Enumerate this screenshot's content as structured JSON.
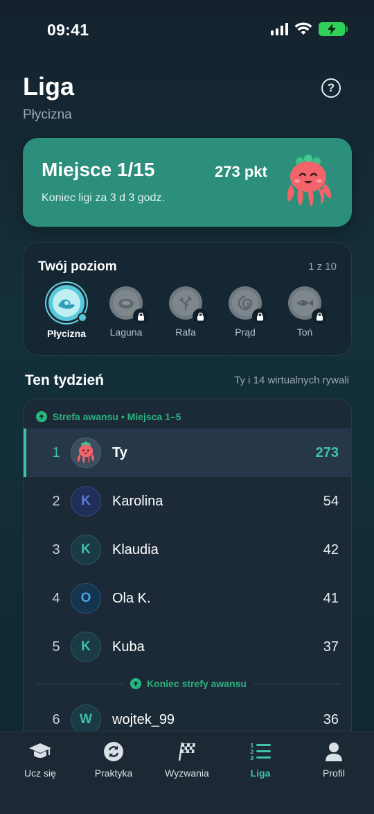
{
  "status": {
    "time": "09:41"
  },
  "header": {
    "title": "Liga",
    "subtitle": "Płycizna",
    "help_icon": "question-circle-icon"
  },
  "rank_card": {
    "place": "Miejsce 1/15",
    "points": "273 pkt",
    "ends": "Koniec ligi za 3 d 3 godz.",
    "colors": {
      "card": "#2b8f7b",
      "mascot": "#f2646a"
    }
  },
  "level": {
    "title": "Twój poziom",
    "count": "1 z 10",
    "items": [
      {
        "label": "Płycizna",
        "icon": "wave-icon",
        "active": true
      },
      {
        "label": "Laguna",
        "icon": "lagoon-icon",
        "locked": true
      },
      {
        "label": "Rafa",
        "icon": "coral-icon",
        "locked": true
      },
      {
        "label": "Prąd",
        "icon": "current-icon",
        "locked": true
      },
      {
        "label": "Toń",
        "icon": "fish-icon",
        "locked": true
      }
    ]
  },
  "week": {
    "title": "Ten tydzień",
    "subtitle": "Ty i 14 wirtualnych rywali",
    "promo_zone": "Strefa awansu • Miejsca 1–5",
    "promo_end": "Koniec strefy awansu",
    "rows": [
      {
        "rank": "1",
        "name": "Ty",
        "points": "273",
        "avatar": "octopus"
      },
      {
        "rank": "2",
        "name": "Karolina",
        "points": "54",
        "initial": "K"
      },
      {
        "rank": "3",
        "name": "Klaudia",
        "points": "42",
        "initial": "K"
      },
      {
        "rank": "4",
        "name": "Ola K.",
        "points": "41",
        "initial": "O"
      },
      {
        "rank": "5",
        "name": "Kuba",
        "points": "37",
        "initial": "K"
      },
      {
        "rank": "6",
        "name": "wojtek_99",
        "points": "36",
        "initial": "W"
      }
    ]
  },
  "tabs": [
    {
      "label": "Ucz się",
      "icon": "graduation-cap-icon"
    },
    {
      "label": "Praktyka",
      "icon": "refresh-icon"
    },
    {
      "label": "Wyzwania",
      "icon": "checkered-flag-icon"
    },
    {
      "label": "Liga",
      "icon": "ranked-list-icon",
      "active": true
    },
    {
      "label": "Profil",
      "icon": "person-icon"
    }
  ],
  "accent": "#3fc3a6",
  "promo_color": "#2bb37f"
}
